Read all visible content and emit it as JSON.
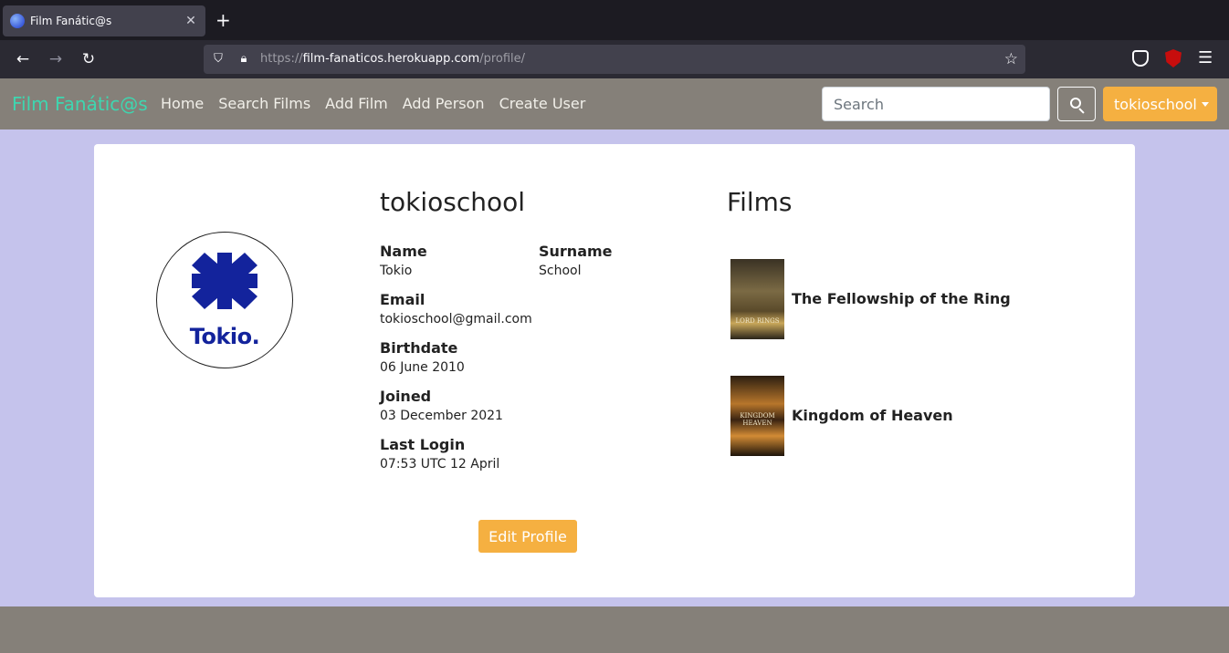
{
  "browser": {
    "tab_title": "Film Fanátic@s",
    "tab_close": "✕",
    "new_tab": "+",
    "url_scheme": "https://",
    "url_host": "film-fanaticos.herokuapp.com",
    "url_path": "/profile/"
  },
  "nav": {
    "brand": "Film Fanátic@s",
    "links": [
      "Home",
      "Search Films",
      "Add Film",
      "Add Person",
      "Create User"
    ],
    "search_placeholder": "Search",
    "user": "tokioschool"
  },
  "profile": {
    "avatar_text": "Tokio.",
    "username": "tokioschool",
    "fields": {
      "name_label": "Name",
      "name": "Tokio",
      "surname_label": "Surname",
      "surname": "School",
      "email_label": "Email",
      "email": "tokioschool@gmail.com",
      "birthdate_label": "Birthdate",
      "birthdate": "06 June 2010",
      "joined_label": "Joined",
      "joined": "03 December 2021",
      "last_login_label": "Last Login",
      "last_login": "07:53 UTC 12 April"
    },
    "edit_label": "Edit Profile"
  },
  "films": {
    "title": "Films",
    "items": [
      {
        "name": "The Fellowship of the Ring",
        "poster_text": "LORD RINGS"
      },
      {
        "name": "Kingdom of Heaven",
        "poster_text": "KINGDOM HEAVEN"
      }
    ]
  },
  "colors": {
    "brand": "#3ed6b0",
    "accent": "#f5b041",
    "nav_bg": "#858079",
    "page_bg": "#c5c3ec"
  }
}
